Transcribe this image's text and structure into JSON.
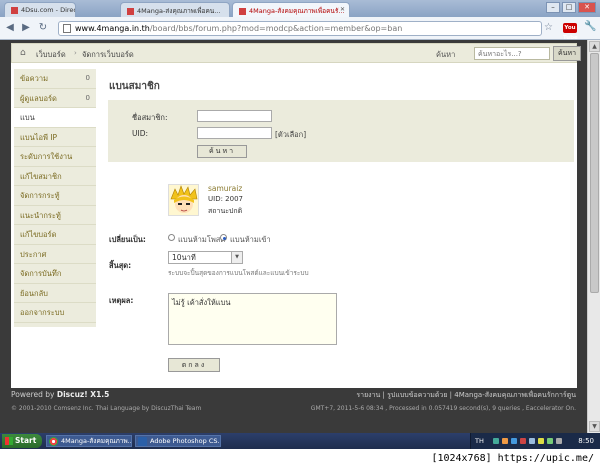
{
  "browser": {
    "tabs": [
      {
        "label": "4Dsu.com - Direct Anime D..."
      },
      {
        "label": "4Manga-ส่งคุณภาพเพื่อคน..."
      },
      {
        "label": "4Manga-สังคมคุณภาพเพื่อคนรั..."
      }
    ],
    "url_host": "www.4manga.in.th",
    "url_path": "/board/bbs/forum.php?mod=modcp&action=member&op=ban",
    "youtube_label": "You Tube"
  },
  "breadcrumb": {
    "item1": "เว็บบอร์ด",
    "separator": "›",
    "item2": "จัดการเว็บบอร์ด",
    "search_label": "ค้นหา",
    "search_placeholder": "ค้นหาอะไร...?",
    "search_button": "ค้นหา"
  },
  "sidebar": {
    "items": [
      {
        "label": "ข้อความ",
        "count": "0"
      },
      {
        "label": "ผู้ดูแลบอร์ด",
        "count": "0"
      },
      {
        "label": "แบน",
        "count": ""
      },
      {
        "label": "แบนไอพี IP",
        "count": ""
      },
      {
        "label": "ระดับการใช้งาน",
        "count": ""
      },
      {
        "label": "แก้ไขสมาชิก",
        "count": ""
      },
      {
        "label": "จัดการกระทู้",
        "count": ""
      },
      {
        "label": "แนะนำกระทู้",
        "count": ""
      },
      {
        "label": "แก้ไขบอร์ด",
        "count": ""
      },
      {
        "label": "ประกาศ",
        "count": ""
      },
      {
        "label": "จัดการบันทึก",
        "count": ""
      },
      {
        "label": "ย้อนกลับ",
        "count": ""
      },
      {
        "label": "ออกจากระบบ",
        "count": ""
      }
    ]
  },
  "main": {
    "title": "แบนสมาชิก",
    "username_label": "ชื่อสมาชิก:",
    "uid_label": "UID:",
    "uid_link": "[ตัวเลือก]",
    "search_button": "ค้นหา",
    "user": {
      "name": "samuraiz",
      "uid": "UID: 2007",
      "status": "สถานะปกติ"
    },
    "change_label": "เปลี่ยนเป็น:",
    "radio_option1": "แบนห้ามโพสต์",
    "radio_option2": "แบนห้ามเข้า",
    "expire_label": "สิ้นสุด:",
    "expire_value": "10นาที",
    "expire_hint": "ระบบจะปิ้นสุดของการแบนโพสต์และแบนเข้าระบบ",
    "reason_label": "เหตุผล:",
    "reason_value": "ไม่รู้ เค้าสั่งให้แบน",
    "submit_button": "ตกลง"
  },
  "footer": {
    "powered_prefix": "Powered by ",
    "powered_brand": "Discuz! X1.5",
    "copyright": "© 2001-2010 Comsenz Inc. Thai Language by DiscuzThai Team",
    "links": "รายงาน  |  รูปแบบข้อความด้วย  |  4Manga-สังคมคุณภาพเพื่อคนรักการ์ตูน",
    "stats": "GMT+7, 2011-5-6 08:34 , Processed in 0.057419 second(s), 9 queries , Eaccelerator On."
  },
  "taskbar": {
    "start": "Start",
    "item1": "4Manga-สังคมคุณภาพ...",
    "item2": "Adobe Photoshop CS...",
    "lang": "TH",
    "clock": "8:50"
  },
  "watermark": "[1024x768] https://upic.me/"
}
